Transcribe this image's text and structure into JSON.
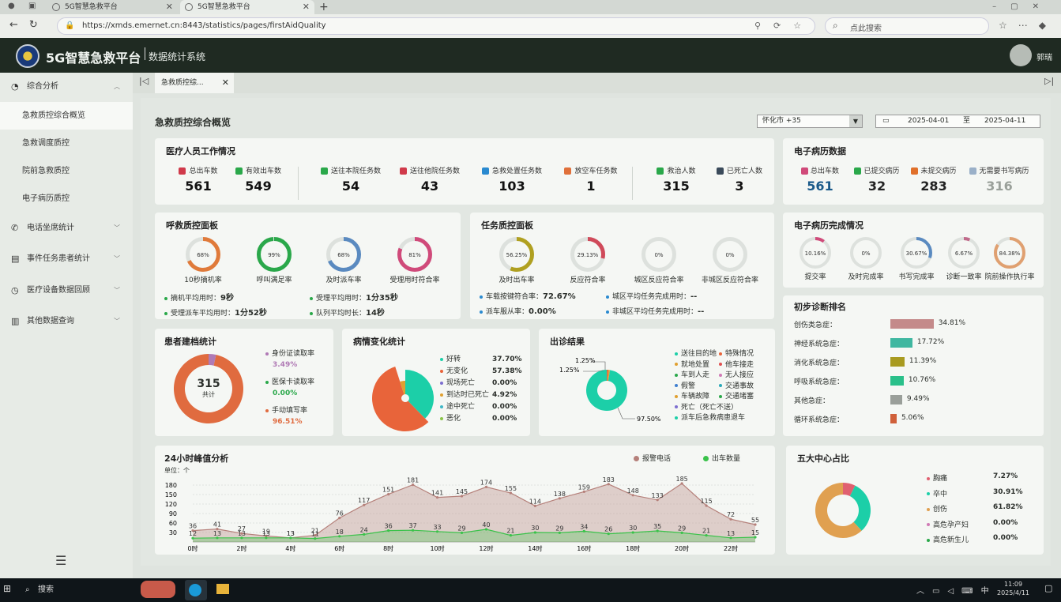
{
  "browser": {
    "tab1": "5G智慧急救平台",
    "tab2": "5G智慧急救平台",
    "url": "https://xmds.emernet.cn:8443/statistics/pages/firstAidQuality",
    "search_placeholder": "点此搜索"
  },
  "app": {
    "title": "5G智慧急救平台",
    "subtitle": "数据统计系统",
    "user": "郭瑞"
  },
  "sidebar": {
    "groups": [
      {
        "label": "综合分析"
      },
      {
        "label": "电话坐席统计"
      },
      {
        "label": "事件任务患者统计"
      },
      {
        "label": "医疗设备数据回顾"
      },
      {
        "label": "其他数据查询"
      }
    ],
    "items": [
      {
        "label": "急救质控综合概览"
      },
      {
        "label": "急救调度质控"
      },
      {
        "label": "院前急救质控"
      },
      {
        "label": "电子病历质控"
      }
    ]
  },
  "content_tab": "急救质控综...",
  "page": {
    "title": "急救质控综合概览",
    "region": "怀化市 +35",
    "date_from": "2025-04-01",
    "date_sep": "至",
    "date_to": "2025-04-11"
  },
  "staff": {
    "title": "医疗人员工作情况",
    "stats": [
      {
        "label": "总出车数",
        "value": "561"
      },
      {
        "label": "有效出车数",
        "value": "549"
      },
      {
        "label": "送往本院任务数",
        "value": "54"
      },
      {
        "label": "送往他院任务数",
        "value": "43"
      },
      {
        "label": "急救处置任务数",
        "value": "103"
      },
      {
        "label": "放空车任务数",
        "value": "1"
      },
      {
        "label": "救治人数",
        "value": "315"
      },
      {
        "label": "已死亡人数",
        "value": "3"
      }
    ]
  },
  "emr": {
    "title": "电子病历数据",
    "stats": [
      {
        "label": "总出车数",
        "value": "561"
      },
      {
        "label": "已提交病历",
        "value": "32"
      },
      {
        "label": "未提交病历",
        "value": "283"
      },
      {
        "label": "无需要书写病历",
        "value": "316"
      }
    ]
  },
  "call": {
    "title": "呼救质控面板",
    "rings": [
      {
        "label": "10秒摘机率",
        "text": "68%",
        "value": 68
      },
      {
        "label": "呼叫满足率",
        "text": "99%",
        "value": 99
      },
      {
        "label": "及时派车率",
        "text": "68%",
        "value": 68
      },
      {
        "label": "受理用时符合率",
        "text": "81%",
        "value": 81
      }
    ],
    "kv": [
      {
        "k": "摘机平均用时：",
        "v": "9秒"
      },
      {
        "k": "受理平均用时：",
        "v": "1分35秒"
      },
      {
        "k": "受理派车平均用时：",
        "v": "1分52秒"
      },
      {
        "k": "队列平均时长：",
        "v": "14秒"
      }
    ]
  },
  "task": {
    "title": "任务质控面板",
    "rings": [
      {
        "label": "及时出车率",
        "text": "56.25%",
        "value": 56.25
      },
      {
        "label": "反应符合率",
        "text": "29.13%",
        "value": 29.13
      },
      {
        "label": "城区反应符合率",
        "text": "0%",
        "value": 0
      },
      {
        "label": "非城区反应符合率",
        "text": "0%",
        "value": 0
      }
    ],
    "kv": [
      {
        "k": "车载按键符合率：",
        "v": "72.67%"
      },
      {
        "k": "城区平均任务完成用时：",
        "v": "--"
      },
      {
        "k": "派车服从率：",
        "v": "0.00%"
      },
      {
        "k": "非城区平均任务完成用时：",
        "v": "--"
      }
    ]
  },
  "emr_done": {
    "title": "电子病历完成情况",
    "rings": [
      {
        "label": "提交率",
        "text": "10.16%",
        "value": 10.16
      },
      {
        "label": "及时完成率",
        "text": "0%",
        "value": 0
      },
      {
        "label": "书写完成率",
        "text": "30.67%",
        "value": 30.67
      },
      {
        "label": "诊断一致率",
        "text": "6.67%",
        "value": 6.67
      },
      {
        "label": "院前操作执行率",
        "text": "84.38%",
        "value": 84.38
      }
    ]
  },
  "patients": {
    "title": "患者建档统计",
    "total": "315",
    "total_label": "共计",
    "legend": [
      {
        "label": "身份证读取率",
        "value": "3.49%",
        "pct": 3.49,
        "color": "#b07ab5"
      },
      {
        "label": "医保卡读取率",
        "value": "0.00%",
        "pct": 0,
        "color": "#2aa84a"
      },
      {
        "label": "手动填写率",
        "value": "96.51%",
        "pct": 96.51,
        "color": "#e06b3f"
      }
    ]
  },
  "condition": {
    "title": "病情变化统计",
    "legend": [
      {
        "label": "好转",
        "value": "37.70%",
        "pct": 37.7,
        "color": "#1ccfa8"
      },
      {
        "label": "无变化",
        "value": "57.38%",
        "pct": 57.38,
        "color": "#e8643a"
      },
      {
        "label": "现场死亡",
        "value": "0.00%",
        "pct": 0,
        "color": "#7d6fd0"
      },
      {
        "label": "到达时已死亡",
        "value": "4.92%",
        "pct": 4.92,
        "color": "#e0a030"
      },
      {
        "label": "途中死亡",
        "value": "0.00%",
        "pct": 0,
        "color": "#3fb7c7"
      },
      {
        "label": "恶化",
        "value": "0.00%",
        "pct": 0,
        "color": "#8ac44a"
      }
    ]
  },
  "outcome": {
    "title": "出诊结果",
    "slices": [
      {
        "text": "1.25%",
        "pct": 1.25
      },
      {
        "text": "1.25%",
        "pct": 1.25
      },
      {
        "text": "97.50%",
        "pct": 97.5
      }
    ],
    "legend": [
      {
        "label": "送往目的地",
        "color": "#1ccfa8"
      },
      {
        "label": "特殊情况",
        "color": "#e8643a"
      },
      {
        "label": "就地处置",
        "color": "#e0a030"
      },
      {
        "label": "他车接走",
        "color": "#e05050"
      },
      {
        "label": "车到人走",
        "color": "#2aa84a"
      },
      {
        "label": "无人接应",
        "color": "#d07ab5"
      },
      {
        "label": "假警",
        "color": "#3f7fd0"
      },
      {
        "label": "交通事故",
        "color": "#2aa8b8"
      },
      {
        "label": "车辆故障",
        "color": "#e0a030"
      },
      {
        "label": "交通堵塞",
        "color": "#2aa84a"
      },
      {
        "label": "死亡（死亡不送）",
        "color": "#7d6fd0"
      },
      {
        "label": "派车后急救病患退车",
        "color": "#1ccfa8"
      }
    ]
  },
  "diagnosis": {
    "title": "初步诊断排名",
    "items": [
      {
        "label": "创伤类急症：",
        "value": "34.81%",
        "pct": 34.81,
        "color": "#c48a8a"
      },
      {
        "label": "神经系统急症：",
        "value": "17.72%",
        "pct": 17.72,
        "color": "#3fb7a0"
      },
      {
        "label": "消化系统急症：",
        "value": "11.39%",
        "pct": 11.39,
        "color": "#a89a20"
      },
      {
        "label": "呼吸系统急症：",
        "value": "10.76%",
        "pct": 10.76,
        "color": "#2ac08a"
      },
      {
        "label": "其他急症：",
        "value": "9.49%",
        "pct": 9.49,
        "color": "#9a9f9a"
      },
      {
        "label": "循环系统急症：",
        "value": "5.06%",
        "pct": 5.06,
        "color": "#d0603a"
      }
    ]
  },
  "centers": {
    "title": "五大中心占比",
    "items": [
      {
        "label": "胸痛",
        "value": "7.27%",
        "pct": 7.27,
        "color": "#e06070"
      },
      {
        "label": "卒中",
        "value": "30.91%",
        "pct": 30.91,
        "color": "#1ccfa8"
      },
      {
        "label": "创伤",
        "value": "61.82%",
        "pct": 61.82,
        "color": "#e0a050"
      },
      {
        "label": "高危孕产妇",
        "value": "0.00%",
        "pct": 0,
        "color": "#d07ab5"
      },
      {
        "label": "高危新生儿",
        "value": "0.00%",
        "pct": 0,
        "color": "#2aa84a"
      }
    ]
  },
  "chart_data": {
    "type": "area",
    "title": "24小时峰值分析",
    "unit": "单位：个",
    "legend": [
      "报警电话",
      "出车数量"
    ],
    "x": [
      "0时",
      "1时",
      "2时",
      "3时",
      "4时",
      "5时",
      "6时",
      "7时",
      "8时",
      "9时",
      "10时",
      "11时",
      "12时",
      "13时",
      "14时",
      "15时",
      "16时",
      "17时",
      "18时",
      "19时",
      "20时",
      "21时",
      "22时",
      "23时"
    ],
    "xticks": [
      "0时",
      "2时",
      "4时",
      "6时",
      "8时",
      "10时",
      "12时",
      "14时",
      "16时",
      "18时",
      "20时",
      "22时"
    ],
    "yticks": [
      30,
      60,
      90,
      120,
      150,
      180
    ],
    "ylim": [
      0,
      200
    ],
    "series": [
      {
        "name": "报警电话",
        "values": [
          36,
          41,
          27,
          19,
          13,
          21,
          76,
          117,
          151,
          181,
          141,
          145,
          174,
          155,
          114,
          138,
          159,
          183,
          148,
          133,
          185,
          115,
          72,
          55
        ],
        "color": "#b5807a"
      },
      {
        "name": "出车数量",
        "values": [
          12,
          13,
          13,
          13,
          13,
          11,
          18,
          24,
          36,
          37,
          33,
          29,
          40,
          21,
          30,
          29,
          34,
          26,
          30,
          35,
          29,
          21,
          13,
          15
        ],
        "color": "#3ac24a"
      }
    ]
  },
  "taskbar": {
    "search": "搜索",
    "time": "11:09",
    "date": "2025/4/11",
    "ime": "中"
  }
}
